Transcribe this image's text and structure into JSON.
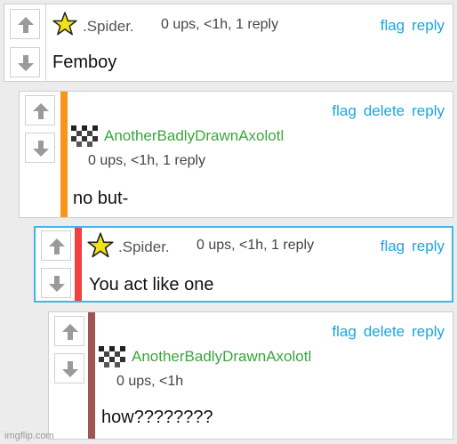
{
  "colors": {
    "link": "#19a4dc",
    "green_username": "#3aa63a",
    "stripe_orange": "#f7941d",
    "stripe_red": "#f04040",
    "stripe_brown": "#a05555",
    "active_border": "#3fb6e8"
  },
  "comments": [
    {
      "username": ".Spider.",
      "meta": "0 ups, <1h, 1 reply",
      "text": "Femboy",
      "actions": [
        "flag",
        "reply"
      ],
      "avatar": "star-icon"
    },
    {
      "username": "AnotherBadlyDrawnAxolotl",
      "meta": "0 ups, <1h, 1 reply",
      "text": "no but-",
      "actions": [
        "flag",
        "delete",
        "reply"
      ],
      "avatar": "pixel-face-icon"
    },
    {
      "username": ".Spider.",
      "meta": "0 ups, <1h, 1 reply",
      "text": "You act like one",
      "actions": [
        "flag",
        "reply"
      ],
      "avatar": "star-icon"
    },
    {
      "username": "AnotherBadlyDrawnAxolotl",
      "meta": "0 ups, <1h",
      "text": "how????????",
      "actions": [
        "flag",
        "delete",
        "reply"
      ],
      "avatar": "pixel-face-icon"
    }
  ],
  "watermark": "imgflip.com"
}
